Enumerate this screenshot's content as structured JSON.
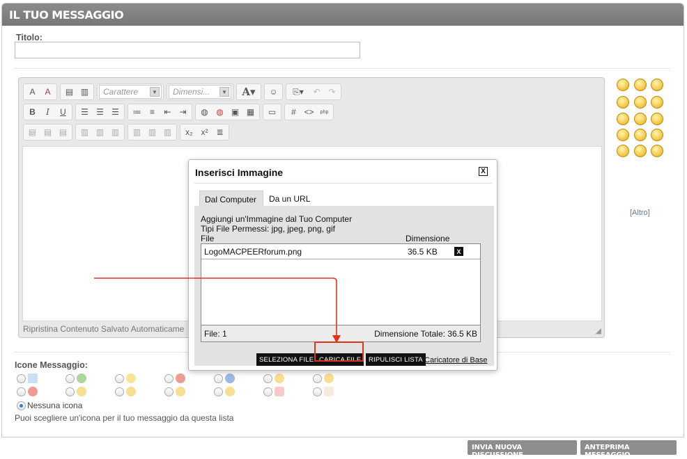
{
  "header": {
    "title": "IL TUO MESSAGGIO"
  },
  "title_field": {
    "label": "Titolo:",
    "value": ""
  },
  "editor": {
    "font_placeholder": "Carattere",
    "size_placeholder": "Dimensi...",
    "status_text": "Ripristina Contenuto Salvato Automaticame"
  },
  "smilies_more": "[Altro]",
  "message_icons": {
    "label": "Icone Messaggio:",
    "none_label": "Nessuna icona",
    "hint": "Puoi scegliere un'icona per il tuo messaggio da questa lista"
  },
  "dialog": {
    "title": "Inserisci Immagine",
    "close": "X",
    "tabs": [
      {
        "label": "Dal Computer"
      },
      {
        "label": "Da un URL"
      }
    ],
    "heading": "Aggiungi un'Immagine dal Tuo Computer",
    "allowed": "Tipi File Permessi: jpg, jpeg, png, gif",
    "col_file": "File",
    "col_size": "Dimensione",
    "files": [
      {
        "name": "LogoMACPEERforum.png",
        "size": "36.5 KB",
        "remove": "X"
      }
    ],
    "file_count": "File: 1",
    "total_size": "Dimensione Totale: 36.5 KB",
    "btn_select": "SELEZIONA FILE",
    "btn_upload": "CARICA FILE",
    "btn_clear": "RIPULISCI LISTA",
    "basic_uploader": "Caricatore di Base"
  },
  "buttons": {
    "new_discussion": "INVIA NUOVA DISCUSSIONE",
    "preview": "ANTEPRIMA MESSAGGIO"
  },
  "colors": {
    "header_bg": "#808080",
    "highlight": "#e3321a",
    "button_bg": "#8d8d8d"
  }
}
